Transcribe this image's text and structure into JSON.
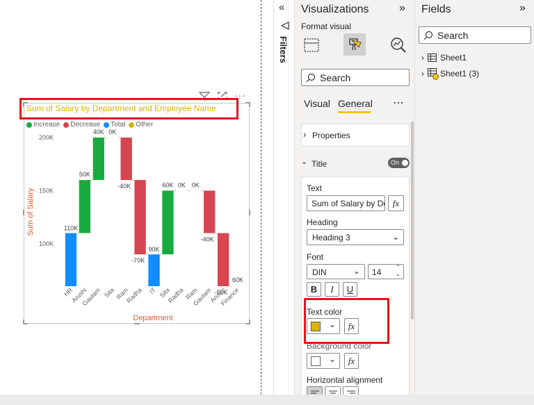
{
  "visual": {
    "title": "Sum of Salary by Department and Employee Name",
    "header_icons": [
      "filter-icon",
      "focus-mode-icon",
      "more-options-icon"
    ],
    "legend": [
      {
        "label": "Increase",
        "color": "#1aab40"
      },
      {
        "label": "Decrease",
        "color": "#d64550"
      },
      {
        "label": "Total",
        "color": "#118dff"
      },
      {
        "label": "Other",
        "color": "#d9b300"
      }
    ]
  },
  "chart_data": {
    "type": "bar",
    "subtype": "waterfall",
    "title": "Sum of Salary by Department and Employee Name",
    "xlabel": "Department",
    "ylabel": "Sum of Salary",
    "ylim": [
      60000,
      200000
    ],
    "yticks": [
      "100K",
      "150K",
      "200K"
    ],
    "categories": [
      "HR",
      "Arushi",
      "Gautam",
      "Sita",
      "Ram",
      "Radha",
      "IT",
      "Sita",
      "Radha",
      "Ram",
      "Gautam",
      "Arushi",
      "Finance"
    ],
    "bars": [
      {
        "kind": "total",
        "start": 60000,
        "end": 110000,
        "label": "110K"
      },
      {
        "kind": "increase",
        "start": 110000,
        "end": 160000,
        "label": "50K"
      },
      {
        "kind": "increase",
        "start": 160000,
        "end": 200000,
        "label": "40K"
      },
      {
        "kind": "increase",
        "start": 200000,
        "end": 200000,
        "label": "0K"
      },
      {
        "kind": "decrease",
        "start": 200000,
        "end": 160000,
        "label": "-40K"
      },
      {
        "kind": "decrease",
        "start": 160000,
        "end": 90000,
        "label": "-70K"
      },
      {
        "kind": "total",
        "start": 60000,
        "end": 90000,
        "label": "90K"
      },
      {
        "kind": "increase",
        "start": 90000,
        "end": 150000,
        "label": "60K"
      },
      {
        "kind": "increase",
        "start": 150000,
        "end": 150000,
        "label": "0K"
      },
      {
        "kind": "increase",
        "start": 150000,
        "end": 150000,
        "label": "0K"
      },
      {
        "kind": "decrease",
        "start": 150000,
        "end": 110000,
        "label": "-40K"
      },
      {
        "kind": "decrease",
        "start": 110000,
        "end": 60000,
        "label": "-50K"
      },
      {
        "kind": "total",
        "start": 60000,
        "end": 60000,
        "label": "60K"
      }
    ]
  },
  "filters_pane": {
    "label": "Filters",
    "collapse_icon": "double-chevron-left-icon"
  },
  "visualizations": {
    "title": "Visualizations",
    "subtitle": "Format visual",
    "search_placeholder": "Search",
    "tabs": [
      "Visual",
      "General"
    ],
    "active_tab": "General",
    "more": "⋯",
    "sections": {
      "properties": "Properties",
      "title": "Title",
      "title_toggle": "On"
    },
    "title_card": {
      "text_label": "Text",
      "text_value": "Sum of Salary by De",
      "fx": "fx",
      "heading_label": "Heading",
      "heading_value": "Heading 3",
      "font_label": "Font",
      "font_family": "DIN",
      "font_size": "14",
      "bold": "B",
      "italic": "I",
      "underline": "U",
      "text_color_label": "Text color",
      "text_color": "#d9b300",
      "background_color_label": "Background color",
      "background_color": "#ffffff",
      "horizontal_alignment_label": "Horizontal alignment"
    }
  },
  "fields": {
    "title": "Fields",
    "search_placeholder": "Search",
    "tables": [
      {
        "name": "Sheet1",
        "icon": "table-icon"
      },
      {
        "name": "Sheet1 (3)",
        "icon": "table-check-icon"
      }
    ]
  }
}
